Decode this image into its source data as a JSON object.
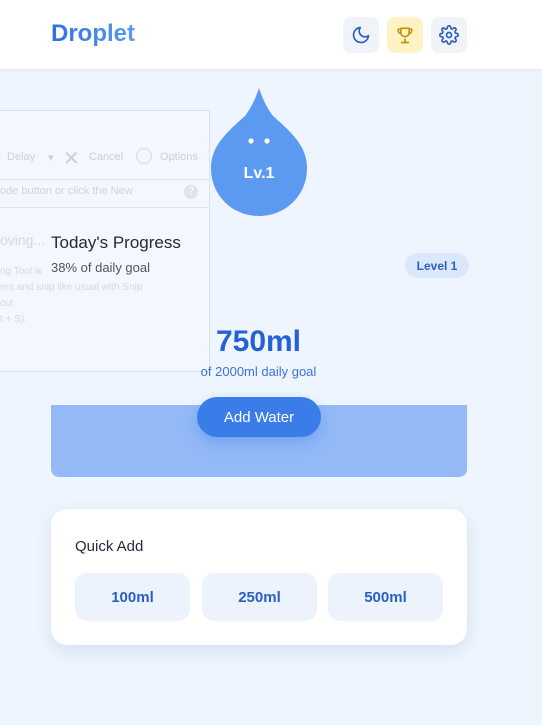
{
  "app": {
    "title": "Droplet",
    "accent_color": "#3b7de8"
  },
  "header": {
    "buttons": [
      {
        "icon": "moon-icon"
      },
      {
        "icon": "trophy-icon"
      },
      {
        "icon": "gear-icon"
      }
    ]
  },
  "overlay": {
    "delay": "Delay",
    "cancel": "Cancel",
    "options": "Options",
    "hint": "ode button or click the New",
    "moving": "oving...",
    "lines": [
      "ng Tool w",
      "res and snip like usual with Snip",
      "cut",
      "t + S)."
    ]
  },
  "mascot": {
    "level_label": "Lv.1"
  },
  "progress": {
    "title": "Today's Progress",
    "subtitle": "38% of daily goal",
    "level_badge": "Level 1",
    "amount": "750ml",
    "goal_text": "of 2000ml daily goal",
    "fraction": 0.375,
    "add_button": "Add Water"
  },
  "quick_add": {
    "title": "Quick Add",
    "options": [
      "100ml",
      "250ml",
      "500ml"
    ]
  }
}
